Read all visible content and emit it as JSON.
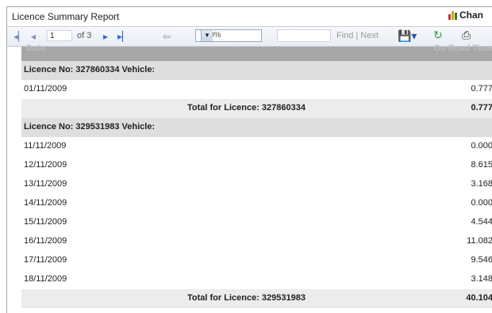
{
  "window": {
    "title": "Licence Summary Report",
    "chart_link": "Chan"
  },
  "toolbar": {
    "page_value": "1",
    "page_of": "of 3",
    "zoom_value": "100%",
    "find_label": "Find",
    "separator": "|",
    "next_label": "Next"
  },
  "report": {
    "header_left": "Date",
    "header_right": "On Road Time",
    "groups": [
      {
        "label": "Licence No: 327860334 Vehicle:",
        "rows": [
          {
            "date": "01/11/2009",
            "value": "0.777"
          }
        ],
        "total_label": "Total for Licence: 327860334",
        "total_value": "0.777"
      },
      {
        "label": "Licence No: 329531983 Vehicle:",
        "rows": [
          {
            "date": "11/11/2009",
            "value": "0.000"
          },
          {
            "date": "12/11/2009",
            "value": "8.615"
          },
          {
            "date": "13/11/2009",
            "value": "3.168"
          },
          {
            "date": "14/11/2009",
            "value": "0.000"
          },
          {
            "date": "15/11/2009",
            "value": "4.544"
          },
          {
            "date": "16/11/2009",
            "value": "11.082"
          },
          {
            "date": "17/11/2009",
            "value": "9.546"
          },
          {
            "date": "18/11/2009",
            "value": "3.148"
          }
        ],
        "total_label": "Total for Licence: 329531983",
        "total_value": "40.104"
      }
    ]
  },
  "colors": {
    "group_bg": "#dedede",
    "total_bg": "#ececec",
    "header_strip": "#a7a7a7"
  }
}
